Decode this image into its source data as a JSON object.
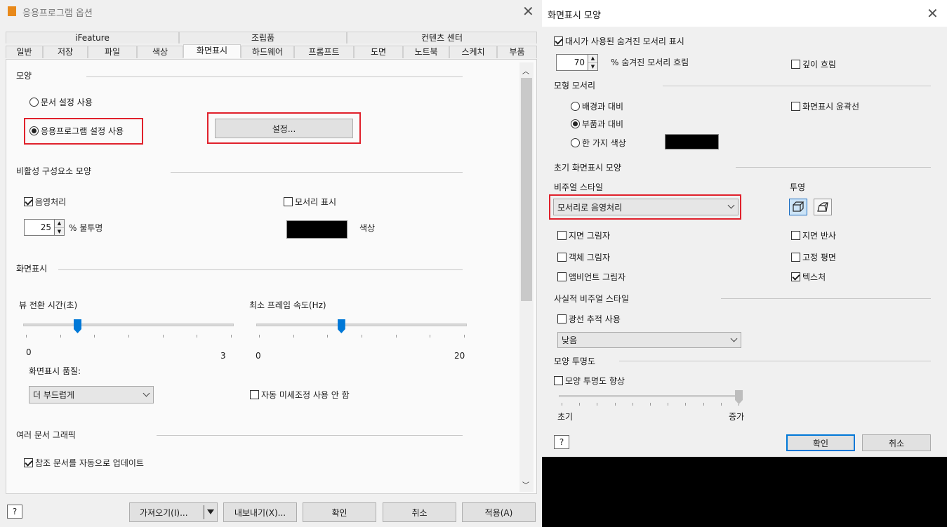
{
  "left": {
    "title": "응용프로그램 옵션",
    "tab_groups": [
      "iFeature",
      "조립품",
      "컨텐츠 센터"
    ],
    "tabs": [
      "일반",
      "저장",
      "파일",
      "색상",
      "화면표시",
      "하드웨어",
      "프롬프트",
      "도면",
      "노트북",
      "스케치",
      "부품"
    ],
    "appearance": {
      "section": "모양",
      "radio_doc": "문서 설정 사용",
      "radio_app": "응용프로그램 설정 사용",
      "settings_btn": "설정..."
    },
    "inactive": {
      "section": "비활성 구성요소 모양",
      "shading": "음영처리",
      "edges": "모서리 표시",
      "opacity_value": "25",
      "opacity_label": "% 불투명",
      "color_label": "색상"
    },
    "display": {
      "section": "화면표시",
      "view_time_label": "뷰 전환 시간(초)",
      "view_time_min": "0",
      "view_time_max": "3",
      "view_time_value": 0.25,
      "min_fps_label": "최소 프레임 속도(Hz)",
      "min_fps_min": "0",
      "min_fps_max": "20",
      "min_fps_value": 0.4,
      "quality_label": "화면표시 품질:",
      "quality_value": "더 부드럽게",
      "auto_tune": "자동 미세조정 사용 안 함"
    },
    "multi": {
      "section": "여러 문서 그래픽",
      "auto_update": "참조 문서를 자동으로 업데이트"
    },
    "buttons": {
      "help": "?",
      "import": "가져오기(I)...",
      "export": "내보내기(X)...",
      "ok": "확인",
      "cancel": "취소",
      "apply": "적용(A)"
    }
  },
  "right": {
    "title": "화면표시 모양",
    "hidden_edges": "대시가 사용된 숨겨진 모서리 표시",
    "hidden_dim_value": "70",
    "hidden_dim_label": "% 숨겨진 모서리 흐림",
    "depth_dim": "깊이 흐림",
    "model_edges": {
      "section": "모형 모서리",
      "bg_contrast": "배경과 대비",
      "part_contrast": "부품과 대비",
      "single_color": "한 가지 색상",
      "silhouette": "화면표시 윤곽선"
    },
    "initial": {
      "section": "초기 화면표시 모양",
      "visual_style_label": "비주얼 스타일",
      "visual_style_value": "모서리로 음영처리",
      "projection_label": "투영",
      "ground_shadow": "지면 그림자",
      "object_shadow": "객체 그림자",
      "ambient_shadow": "앰비언트 그림자",
      "ground_reflection": "지면 반사",
      "ground_plane": "고정 평면",
      "texture": "텍스처"
    },
    "realistic": {
      "section": "사실적 비주얼 스타일",
      "ray_tracing": "광선 추적 사용",
      "quality_value": "낮음"
    },
    "transparency": {
      "section": "모양 투명도",
      "enhance": "모양 투명도 향상",
      "min_label": "초기",
      "max_label": "증가",
      "value": 1.0
    },
    "buttons": {
      "help": "?",
      "ok": "확인",
      "cancel": "취소"
    }
  }
}
